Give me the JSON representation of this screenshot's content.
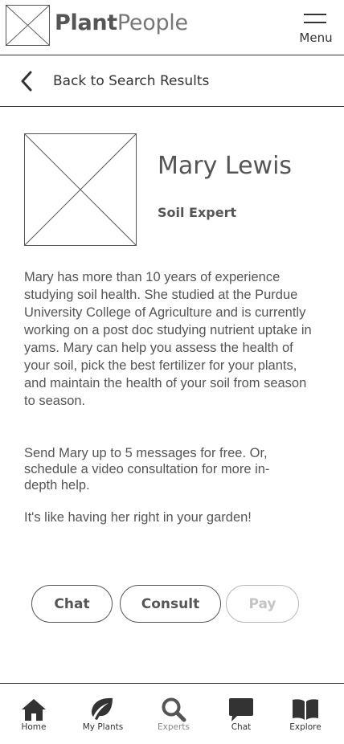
{
  "header": {
    "brand_bold": "Plant",
    "brand_light": "People",
    "logo_icon": "image-placeholder-icon",
    "menu_icon": "hamburger-icon",
    "menu_label": "Menu"
  },
  "back": {
    "icon": "chevron-left-icon",
    "label": "Back to Search Results"
  },
  "profile": {
    "photo_icon": "image-placeholder-icon",
    "name": "Mary Lewis",
    "role": "Soil Expert",
    "bio": "Mary has more than 10 years of experience studying soil health. She studied at the Purdue University College of Agriculture and is currently working on a post doc studying nutrient uptake in yams. Mary can help you assess the health of your soil, pick the best fertilizer for your plants, and maintain the health of your soil from season to season.",
    "offer": "Send Mary up to 5 messages for free. Or, schedule a video consultation for more in-depth help.",
    "tagline": "It's like having her right in your garden!"
  },
  "actions": {
    "chat_label": "Chat",
    "consult_label": "Consult",
    "pay_label": "Pay"
  },
  "tabs": [
    {
      "label": "Home",
      "icon": "home-icon"
    },
    {
      "label": "My Plants",
      "icon": "leaf-icon"
    },
    {
      "label": "Experts",
      "icon": "search-icon",
      "active": true
    },
    {
      "label": "Chat",
      "icon": "chat-bubble-icon"
    },
    {
      "label": "Explore",
      "icon": "book-icon"
    }
  ],
  "colors": {
    "text": "#555555",
    "border": "#333333",
    "disabled": "#c4c4c4",
    "background": "#ffffff"
  }
}
